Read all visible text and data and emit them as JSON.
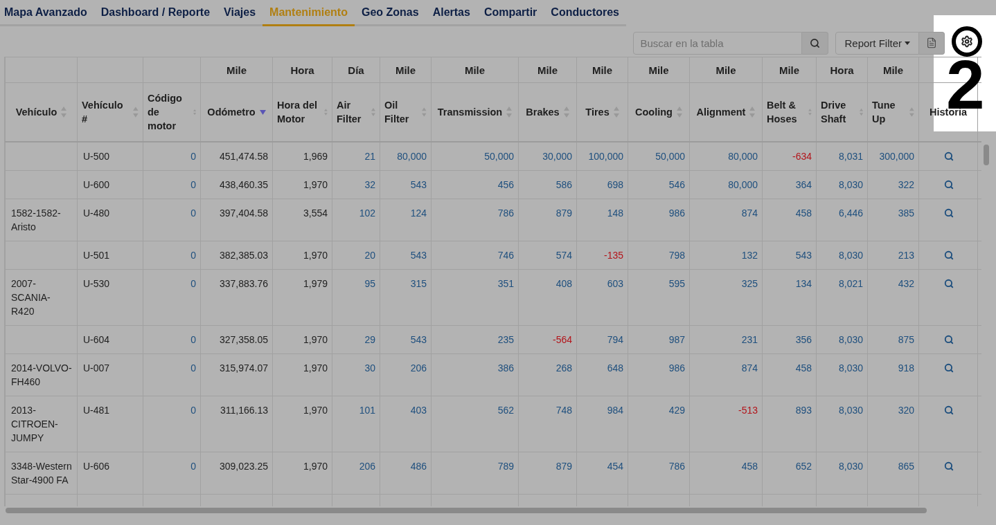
{
  "nav": {
    "tabs": [
      {
        "label": "Mapa Avanzado",
        "selected": false
      },
      {
        "label": "Dashboard / Reporte",
        "selected": false
      },
      {
        "label": "Viajes",
        "selected": false
      },
      {
        "label": "Mantenimiento",
        "selected": true
      },
      {
        "label": "Geo Zonas",
        "selected": false
      },
      {
        "label": "Alertas",
        "selected": false
      },
      {
        "label": "Compartir",
        "selected": false
      },
      {
        "label": "Conductores",
        "selected": false
      }
    ]
  },
  "toolbar": {
    "search": {
      "placeholder": "Buscar en la tabla"
    },
    "report_filter": "Report Filter"
  },
  "tour": {
    "step": "2"
  },
  "table": {
    "columns": [
      {
        "label": "Vehículo",
        "sortable": true,
        "sorted": false
      },
      {
        "label": "Vehículo #",
        "sortable": true,
        "sorted": false
      },
      {
        "label": "Código de motor",
        "sortable": true,
        "sorted": false
      },
      {
        "label": "Odómetro",
        "unit": "Mile",
        "sortable": true,
        "sorted": true
      },
      {
        "label": "Hora del Motor",
        "unit": "Hora",
        "sortable": true,
        "sorted": false
      },
      {
        "label": "Air Filter",
        "unit": "Día",
        "sortable": true,
        "sorted": false
      },
      {
        "label": "Oil Filter",
        "unit": "Mile",
        "sortable": true,
        "sorted": false
      },
      {
        "label": "Transmission",
        "unit": "Mile",
        "sortable": true,
        "sorted": false
      },
      {
        "label": "Brakes",
        "unit": "Mile",
        "sortable": true,
        "sorted": false
      },
      {
        "label": "Tires",
        "unit": "Mile",
        "sortable": true,
        "sorted": false
      },
      {
        "label": "Cooling",
        "unit": "Mile",
        "sortable": true,
        "sorted": false
      },
      {
        "label": "Alignment",
        "unit": "Mile",
        "sortable": true,
        "sorted": false
      },
      {
        "label": "Belt & Hoses",
        "unit": "Mile",
        "sortable": true,
        "sorted": false
      },
      {
        "label": "Drive Shaft",
        "unit": "Hora",
        "sortable": true,
        "sorted": false
      },
      {
        "label": "Tune Up",
        "unit": "Mile",
        "sortable": true,
        "sorted": false
      },
      {
        "label": "Historia",
        "sortable": false,
        "sorted": false
      }
    ],
    "rows": [
      {
        "unit": "U-500",
        "engine_code": "0",
        "odometer": "451,474.58",
        "engine_hours": "1,969",
        "intervals": [
          {
            "v": "21",
            "overdue": false
          },
          {
            "v": "80,000",
            "overdue": false
          },
          {
            "v": "50,000",
            "overdue": false
          },
          {
            "v": "30,000",
            "overdue": false
          },
          {
            "v": "100,000",
            "overdue": false
          },
          {
            "v": "50,000",
            "overdue": false
          },
          {
            "v": "80,000",
            "overdue": false
          },
          {
            "v": "-634",
            "overdue": true
          },
          {
            "v": "8,031",
            "overdue": false
          },
          {
            "v": "300,000",
            "overdue": false
          }
        ]
      },
      {
        "unit": "U-600",
        "engine_code": "0",
        "odometer": "438,460.35",
        "engine_hours": "1,970",
        "intervals": [
          {
            "v": "32",
            "overdue": false
          },
          {
            "v": "543",
            "overdue": false
          },
          {
            "v": "456",
            "overdue": false
          },
          {
            "v": "586",
            "overdue": false
          },
          {
            "v": "698",
            "overdue": false
          },
          {
            "v": "546",
            "overdue": false
          },
          {
            "v": "80,000",
            "overdue": false
          },
          {
            "v": "364",
            "overdue": false
          },
          {
            "v": "8,030",
            "overdue": false
          },
          {
            "v": "322",
            "overdue": false
          }
        ]
      },
      {
        "vehicle": "1582-1582-Aristo",
        "unit": "U-480",
        "engine_code": "0",
        "odometer": "397,404.58",
        "engine_hours": "3,554",
        "intervals": [
          {
            "v": "102",
            "overdue": false
          },
          {
            "v": "124",
            "overdue": false
          },
          {
            "v": "786",
            "overdue": false
          },
          {
            "v": "879",
            "overdue": false
          },
          {
            "v": "148",
            "overdue": false
          },
          {
            "v": "986",
            "overdue": false
          },
          {
            "v": "874",
            "overdue": false
          },
          {
            "v": "458",
            "overdue": false
          },
          {
            "v": "6,446",
            "overdue": false
          },
          {
            "v": "385",
            "overdue": false
          }
        ]
      },
      {
        "unit": "U-501",
        "engine_code": "0",
        "odometer": "382,385.03",
        "engine_hours": "1,970",
        "intervals": [
          {
            "v": "20",
            "overdue": false
          },
          {
            "v": "543",
            "overdue": false
          },
          {
            "v": "746",
            "overdue": false
          },
          {
            "v": "574",
            "overdue": false
          },
          {
            "v": "-135",
            "overdue": true
          },
          {
            "v": "798",
            "overdue": false
          },
          {
            "v": "132",
            "overdue": false
          },
          {
            "v": "543",
            "overdue": false
          },
          {
            "v": "8,030",
            "overdue": false
          },
          {
            "v": "213",
            "overdue": false
          }
        ]
      },
      {
        "vehicle": "2007-SCANIA-R420",
        "unit": "U-530",
        "engine_code": "0",
        "odometer": "337,883.76",
        "engine_hours": "1,979",
        "intervals": [
          {
            "v": "95",
            "overdue": false
          },
          {
            "v": "315",
            "overdue": false
          },
          {
            "v": "351",
            "overdue": false
          },
          {
            "v": "408",
            "overdue": false
          },
          {
            "v": "603",
            "overdue": false
          },
          {
            "v": "595",
            "overdue": false
          },
          {
            "v": "325",
            "overdue": false
          },
          {
            "v": "134",
            "overdue": false
          },
          {
            "v": "8,021",
            "overdue": false
          },
          {
            "v": "432",
            "overdue": false
          }
        ]
      },
      {
        "unit": "U-604",
        "engine_code": "0",
        "odometer": "327,358.05",
        "engine_hours": "1,970",
        "intervals": [
          {
            "v": "29",
            "overdue": false
          },
          {
            "v": "543",
            "overdue": false
          },
          {
            "v": "235",
            "overdue": false
          },
          {
            "v": "-564",
            "overdue": true
          },
          {
            "v": "794",
            "overdue": false
          },
          {
            "v": "987",
            "overdue": false
          },
          {
            "v": "231",
            "overdue": false
          },
          {
            "v": "356",
            "overdue": false
          },
          {
            "v": "8,030",
            "overdue": false
          },
          {
            "v": "875",
            "overdue": false
          }
        ]
      },
      {
        "vehicle": "2014-VOLVO-FH460",
        "unit": "U-007",
        "engine_code": "0",
        "odometer": "315,974.07",
        "engine_hours": "1,970",
        "intervals": [
          {
            "v": "30",
            "overdue": false
          },
          {
            "v": "206",
            "overdue": false
          },
          {
            "v": "386",
            "overdue": false
          },
          {
            "v": "268",
            "overdue": false
          },
          {
            "v": "648",
            "overdue": false
          },
          {
            "v": "986",
            "overdue": false
          },
          {
            "v": "874",
            "overdue": false
          },
          {
            "v": "458",
            "overdue": false
          },
          {
            "v": "8,030",
            "overdue": false
          },
          {
            "v": "918",
            "overdue": false
          }
        ]
      },
      {
        "vehicle": "2013-CITROEN-JUMPY",
        "unit": "U-481",
        "engine_code": "0",
        "odometer": "311,166.13",
        "engine_hours": "1,970",
        "intervals": [
          {
            "v": "101",
            "overdue": false
          },
          {
            "v": "403",
            "overdue": false
          },
          {
            "v": "562",
            "overdue": false
          },
          {
            "v": "748",
            "overdue": false
          },
          {
            "v": "984",
            "overdue": false
          },
          {
            "v": "429",
            "overdue": false
          },
          {
            "v": "-513",
            "overdue": true
          },
          {
            "v": "893",
            "overdue": false
          },
          {
            "v": "8,030",
            "overdue": false
          },
          {
            "v": "320",
            "overdue": false
          }
        ]
      },
      {
        "vehicle": "3348-Western Star-4900 FA",
        "unit": "U-606",
        "engine_code": "0",
        "odometer": "309,023.25",
        "engine_hours": "1,970",
        "intervals": [
          {
            "v": "206",
            "overdue": false
          },
          {
            "v": "486",
            "overdue": false
          },
          {
            "v": "789",
            "overdue": false
          },
          {
            "v": "879",
            "overdue": false
          },
          {
            "v": "454",
            "overdue": false
          },
          {
            "v": "786",
            "overdue": false
          },
          {
            "v": "458",
            "overdue": false
          },
          {
            "v": "652",
            "overdue": false
          },
          {
            "v": "8,030",
            "overdue": false
          },
          {
            "v": "865",
            "overdue": false
          }
        ]
      }
    ]
  }
}
